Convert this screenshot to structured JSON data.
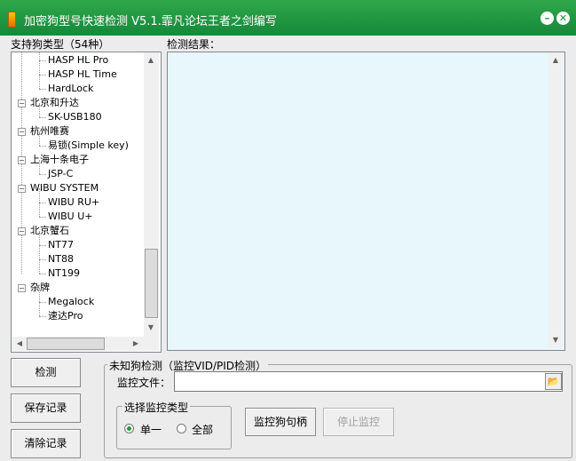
{
  "window": {
    "title": "加密狗型号快速检测 V5.1.霏凡论坛王者之剑编写",
    "minimize_glyph": "–",
    "close_glyph": "✕"
  },
  "tree_label": "支持狗类型（54种）",
  "results_label": "检测结果：",
  "tree": {
    "items": [
      {
        "label": "HASP HL Pro",
        "level": 1,
        "group": false
      },
      {
        "label": "HASP HL Time",
        "level": 1,
        "group": false
      },
      {
        "label": "HardLock",
        "level": 1,
        "group": false
      },
      {
        "label": "北京和升达",
        "level": 0,
        "group": true
      },
      {
        "label": "SK-USB180",
        "level": 1,
        "group": false
      },
      {
        "label": "杭州唯赛",
        "level": 0,
        "group": true
      },
      {
        "label": "易锁(Simple key)",
        "level": 1,
        "group": false
      },
      {
        "label": "上海十条电子",
        "level": 0,
        "group": true
      },
      {
        "label": "JSP-C",
        "level": 1,
        "group": false
      },
      {
        "label": "WIBU SYSTEM",
        "level": 0,
        "group": true
      },
      {
        "label": "WIBU RU+",
        "level": 1,
        "group": false
      },
      {
        "label": "WIBU U+",
        "level": 1,
        "group": false
      },
      {
        "label": "北京蟹石",
        "level": 0,
        "group": true
      },
      {
        "label": "NT77",
        "level": 1,
        "group": false
      },
      {
        "label": "NT88",
        "level": 1,
        "group": false
      },
      {
        "label": "NT199",
        "level": 1,
        "group": false
      },
      {
        "label": "杂牌",
        "level": 0,
        "group": true
      },
      {
        "label": "Megalock",
        "level": 1,
        "group": false
      },
      {
        "label": "速达Pro",
        "level": 1,
        "group": false
      }
    ]
  },
  "buttons": {
    "detect": "检测",
    "save_log": "保存记录",
    "clear_log": "清除记录",
    "monitor_handle": "监控狗句柄",
    "stop_monitor": "停止监控"
  },
  "unknown_group": {
    "title": "未知狗检测（监控VID/PID检测）",
    "file_label": "监控文件：",
    "file_value": ""
  },
  "monitor_type": {
    "title": "选择监控类型",
    "options": [
      "单一",
      "全部"
    ],
    "selected": "单一"
  },
  "icons": {
    "app": "key-icon",
    "browse": "folder-open-icon",
    "scroll_up": "▲",
    "scroll_down": "▼",
    "scroll_left": "◀",
    "scroll_right": "▶"
  },
  "colors": {
    "titlebar": "#1f9a42",
    "results_bg": "#e8f7fc",
    "radio_dot": "#1a9b3a"
  }
}
